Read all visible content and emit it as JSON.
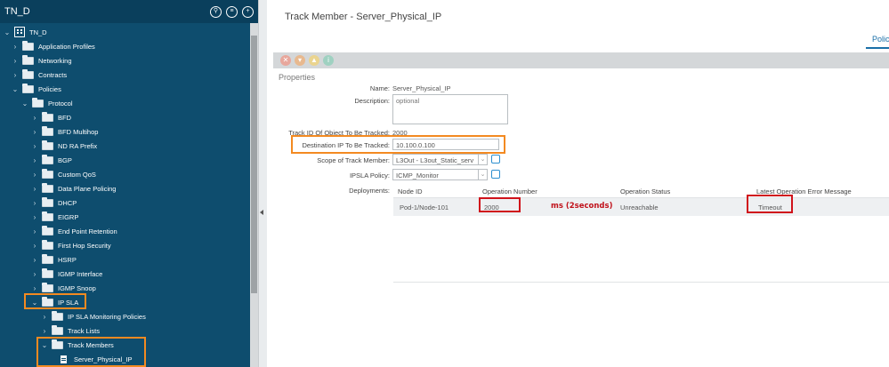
{
  "sidebar": {
    "title": "TN_D",
    "header_icons": [
      "notification-icon",
      "list-icon",
      "add-icon"
    ],
    "tree": [
      {
        "label": "TN_D",
        "icon": "tenant-icon",
        "chevron": "expanded"
      },
      {
        "label": "Application Profiles",
        "icon": "folder-icon",
        "chevron": "collapsed"
      },
      {
        "label": "Networking",
        "icon": "folder-icon",
        "chevron": "collapsed"
      },
      {
        "label": "Contracts",
        "icon": "folder-icon",
        "chevron": "collapsed"
      },
      {
        "label": "Policies",
        "icon": "folder-icon",
        "chevron": "expanded"
      },
      {
        "label": "Protocol",
        "icon": "folder-icon",
        "chevron": "expanded"
      },
      {
        "label": "BFD",
        "icon": "folder-icon",
        "chevron": "collapsed"
      },
      {
        "label": "BFD Multihop",
        "icon": "folder-icon",
        "chevron": "collapsed"
      },
      {
        "label": "ND RA Prefix",
        "icon": "folder-icon",
        "chevron": "collapsed"
      },
      {
        "label": "BGP",
        "icon": "folder-icon",
        "chevron": "collapsed"
      },
      {
        "label": "Custom QoS",
        "icon": "folder-icon",
        "chevron": "collapsed"
      },
      {
        "label": "Data Plane Policing",
        "icon": "folder-icon",
        "chevron": "collapsed"
      },
      {
        "label": "DHCP",
        "icon": "folder-icon",
        "chevron": "collapsed"
      },
      {
        "label": "EIGRP",
        "icon": "folder-icon",
        "chevron": "collapsed"
      },
      {
        "label": "End Point Retention",
        "icon": "folder-icon",
        "chevron": "collapsed"
      },
      {
        "label": "First Hop Security",
        "icon": "folder-icon",
        "chevron": "collapsed"
      },
      {
        "label": "HSRP",
        "icon": "folder-icon",
        "chevron": "collapsed"
      },
      {
        "label": "IGMP Interface",
        "icon": "folder-icon",
        "chevron": "collapsed"
      },
      {
        "label": "IGMP Snoop",
        "icon": "folder-icon",
        "chevron": "collapsed"
      },
      {
        "label": "IP SLA",
        "icon": "folder-icon",
        "chevron": "expanded"
      },
      {
        "label": "IP SLA Monitoring Policies",
        "icon": "folder-icon",
        "chevron": "collapsed"
      },
      {
        "label": "Track Lists",
        "icon": "folder-icon",
        "chevron": "collapsed"
      },
      {
        "label": "Track Members",
        "icon": "folder-icon",
        "chevron": "expanded"
      },
      {
        "label": "Server_Physical_IP",
        "icon": "document-icon",
        "chevron": "none"
      }
    ]
  },
  "main": {
    "title": "Track Member - Server_Physical_IP",
    "tab": "Polic",
    "toolbar_icons": [
      "close-icon",
      "down-icon",
      "warning-icon",
      "info-icon"
    ],
    "section_title": "Properties",
    "fields": {
      "name_label": "Name:",
      "name_value": "Server_Physical_IP",
      "description_label": "Description:",
      "description_placeholder": "optional",
      "track_id_label": "Track ID Of Object To Be Tracked:",
      "track_id_value": "2000",
      "dest_ip_label": "Destination IP To Be Tracked:",
      "dest_ip_value": "10.100.0.100",
      "scope_label": "Scope of Track Member:",
      "scope_value": "L3Out - L3out_Static_serv",
      "ipsla_label": "IPSLA Policy:",
      "ipsla_value": "ICMP_Monitor",
      "deployments_label": "Deployments:"
    },
    "deployments": {
      "columns": [
        "Node ID",
        "Operation Number",
        "Operation Status",
        "Latest Operation Error Message"
      ],
      "rows": [
        {
          "node_id": "Pod-1/Node-101",
          "operation_number": "2000",
          "operation_status": "Unreachable",
          "error_message": "Timeout"
        }
      ]
    },
    "annotation": "ms (2seconds)"
  },
  "colors": {
    "sidebar_bg": "#0e4d6e",
    "highlight_orange": "#f38a21",
    "highlight_red": "#d0121b",
    "accent_blue": "#1a6fa8"
  }
}
